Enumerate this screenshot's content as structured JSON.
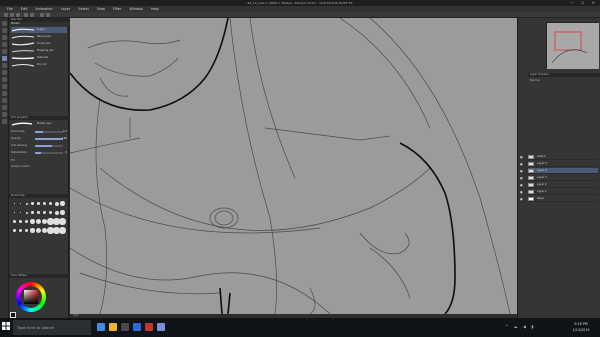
{
  "window": {
    "title": "96_10_past-1 (3600 x 3600px, 300dpi) 39.6% - CLIP STUDIO PAINT EX",
    "controls": "— ☐ ✕"
  },
  "menu": [
    "File",
    "Edit",
    "Animation",
    "Layer",
    "Select",
    "View",
    "Filter",
    "Window",
    "Help"
  ],
  "brush_panel": {
    "title": "Sub Tool",
    "tab": "Marker",
    "items": [
      "G-pen",
      "Real G-pen",
      "Turnip pen",
      "Mapping pen",
      "Textured",
      "Dry ink"
    ],
    "selected_index": 0
  },
  "tool_property": {
    "title": "Tool property",
    "brush_name": "Marker pen",
    "rows": [
      {
        "label": "Brush Size",
        "value": "4.5",
        "level": 0.3
      },
      {
        "label": "Opacity",
        "value": "100",
        "level": 1.0
      },
      {
        "label": "Anti-aliasing",
        "value": "",
        "level": 0.6
      },
      {
        "label": "Stabilization",
        "value": "6",
        "level": 0.2
      }
    ],
    "checks": [
      "Fill",
      "Snap to vector"
    ]
  },
  "brush_size_panel": {
    "title": "Brush Size"
  },
  "color_panel": {
    "title": "Color Wheel",
    "main_color": "#111111",
    "hue_color": "#e02020"
  },
  "canvas": {
    "background": "#9b9b9b",
    "zoom": "39.6",
    "angle": "0.0"
  },
  "navigator": {
    "title": "Navigator"
  },
  "layer_property": {
    "title": "Layer Property",
    "blend_mode": "Normal",
    "opacity": "100"
  },
  "layers": [
    {
      "name": "100 % Normal",
      "sub": "sketch",
      "selected": false
    },
    {
      "name": "100 % Normal",
      "sub": "Layer 5",
      "selected": false
    },
    {
      "name": "100 % Normal",
      "sub": "Layer 4",
      "selected": true
    },
    {
      "name": "100 % Normal",
      "sub": "Layer 3",
      "selected": false
    },
    {
      "name": "100 % Normal",
      "sub": "Layer 2",
      "selected": false
    },
    {
      "name": "100 % Normal",
      "sub": "Layer 1",
      "selected": false
    },
    {
      "name": "100 % Normal",
      "sub": "Paper",
      "selected": false
    }
  ],
  "taskbar": {
    "search_placeholder": "Type here to search",
    "time": "9:18 PM",
    "date": "1/15/2019",
    "app_colors": [
      "#3c8de0",
      "#f0b429",
      "#4a4a4a",
      "#2c6bd6",
      "#c0392b",
      "#7b8fd6"
    ]
  },
  "icons": [
    "windows-start-icon",
    "search-icon",
    "task-view-icon",
    "folder-icon",
    "browser-icon",
    "store-icon",
    "clip-studio-icon",
    "eye-icon",
    "brush-icon"
  ]
}
